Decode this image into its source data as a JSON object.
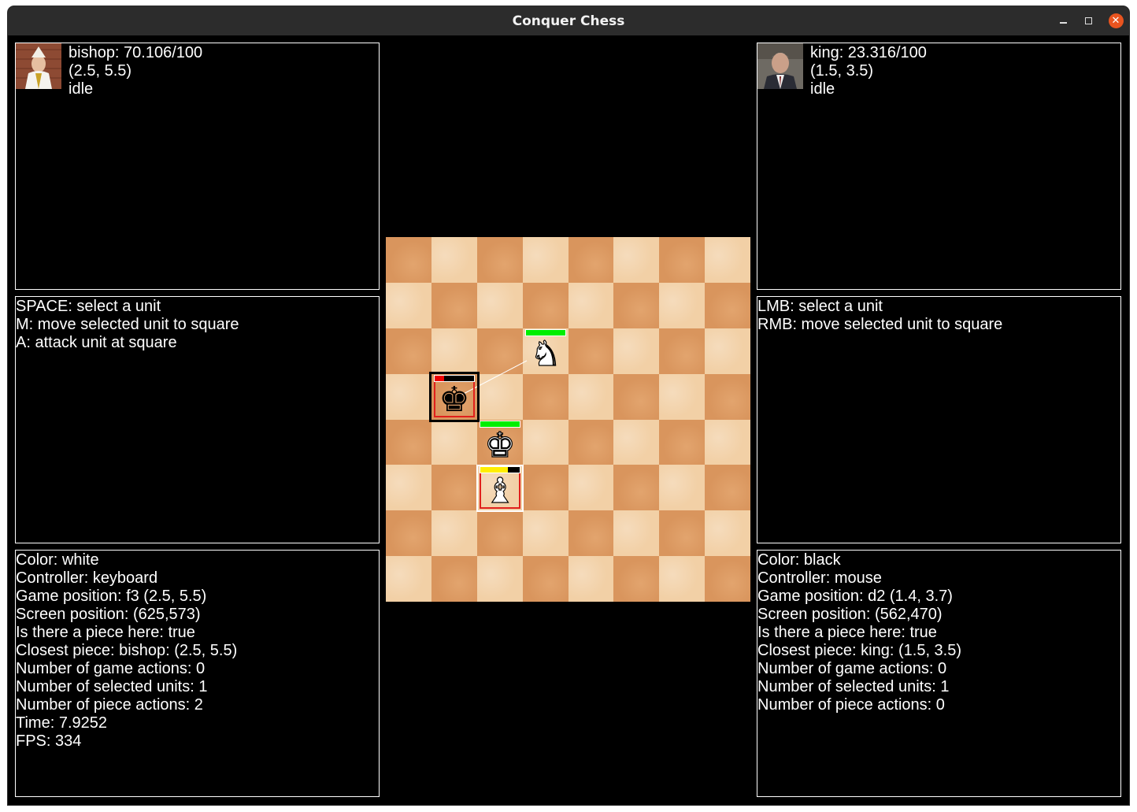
{
  "window": {
    "title": "Conquer Chess"
  },
  "colors": {
    "health_full": "#00ee00",
    "health_low": "#ee0000",
    "health_mid": "#ffee00",
    "selection_frame": "#e0201c"
  },
  "left": {
    "unit": {
      "portrait": "bishop-portrait",
      "lines": [
        "bishop: 70.106/100",
        "(2.5, 5.5)",
        "idle"
      ]
    },
    "controls": {
      "lines": [
        "SPACE: select a unit",
        "M: move selected unit to square",
        "A: attack unit at square"
      ]
    },
    "debug": {
      "lines": [
        "Color: white",
        "Controller: keyboard",
        "Game position: f3 (2.5, 5.5)",
        "Screen position: (625,573)",
        "Is there a piece here: true",
        "Closest piece: bishop: (2.5, 5.5)",
        "Number of game actions: 0",
        "Number of selected units: 1",
        "Number of piece actions: 2",
        "Time: 7.9252",
        "FPS: 334"
      ]
    }
  },
  "right": {
    "unit": {
      "portrait": "king-portrait",
      "lines": [
        "king: 23.316/100",
        "(1.5, 3.5)",
        "idle"
      ]
    },
    "controls": {
      "lines": [
        "LMB: select a unit",
        "RMB: move selected unit to square"
      ]
    },
    "debug": {
      "lines": [
        "Color: black",
        "Controller: mouse",
        "Game position: d2 (1.4, 3.7)",
        "Screen position: (562,470)",
        "Is there a piece here: true",
        "Closest piece: king: (1.5, 3.5)",
        "Number of game actions: 0",
        "Number of selected units: 1",
        "Number of piece actions: 0"
      ]
    }
  },
  "board": {
    "pieces": [
      {
        "name": "white-knight",
        "glyph": "♞",
        "color": "white",
        "health": 1.0
      },
      {
        "name": "black-king",
        "glyph": "♚",
        "color": "black",
        "health": 0.23316,
        "selected": true
      },
      {
        "name": "white-king",
        "glyph": "♚",
        "color": "white",
        "health": 1.0
      },
      {
        "name": "white-bishop",
        "glyph": "♝",
        "color": "white",
        "health": 0.70106,
        "selected": true
      }
    ]
  }
}
